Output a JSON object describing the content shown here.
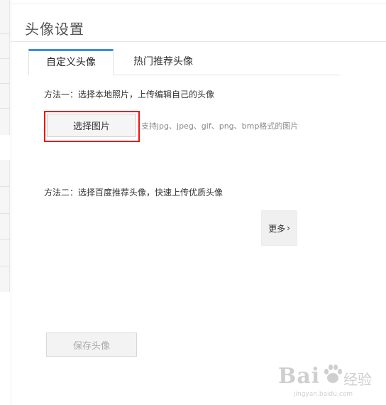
{
  "page": {
    "title": "头像设置"
  },
  "tabs": [
    {
      "label": "自定义头像",
      "active": true
    },
    {
      "label": "热门推荐头像",
      "active": false
    }
  ],
  "method1": {
    "text": "方法一：选择本地照片，上传编辑自己的头像",
    "choose_button": "选择图片",
    "format_hint": "支持jpg、jpeg、gif、png、bmp格式的图片"
  },
  "method2": {
    "text": "方法二：选择百度推荐头像，快速上传优质头像",
    "more_button": "更多"
  },
  "save_button": "保存头像",
  "watermark": {
    "logo": "Bai",
    "logo_suffix": "经验",
    "site": "jingyan.baidu.com"
  },
  "colors": {
    "tab_accent": "#3a8ee6",
    "highlight": "#ee1111"
  }
}
